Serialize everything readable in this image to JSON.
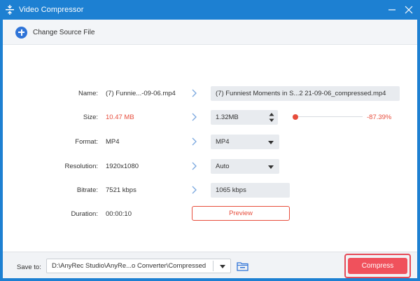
{
  "window": {
    "title": "Video Compressor"
  },
  "toolbar": {
    "change_source_label": "Change Source File"
  },
  "form": {
    "name": {
      "label": "Name:",
      "source": "(7) Funnie...-09-06.mp4",
      "output": "(7) Funniest Moments in S...2 21-09-06_compressed.mp4"
    },
    "size": {
      "label": "Size:",
      "source": "10.47 MB",
      "output": "1.32MB",
      "reduction": "-87.39%"
    },
    "format": {
      "label": "Format:",
      "source": "MP4",
      "output": "MP4"
    },
    "resolution": {
      "label": "Resolution:",
      "source": "1920x1080",
      "output": "Auto"
    },
    "bitrate": {
      "label": "Bitrate:",
      "source": "7521 kbps",
      "output": "1065 kbps"
    },
    "duration": {
      "label": "Duration:",
      "source": "00:00:10"
    },
    "preview_label": "Preview"
  },
  "footer": {
    "save_to_label": "Save to:",
    "save_path": "D:\\AnyRec Studio\\AnyRe...o Converter\\Compressed",
    "compress_label": "Compress"
  },
  "icons": {
    "app": "compress-icon",
    "minimize": "minimize-icon",
    "close": "close-icon",
    "add": "plus-circle-icon",
    "arrow": "chevron-right-icon",
    "dropdown": "caret-down-icon",
    "stepper": "up-down-stepper-icon",
    "folder": "folder-icon"
  },
  "colors": {
    "titlebar": "#1d80d2",
    "accent_blue": "#2f74d8",
    "accent_red": "#f0515c",
    "highlight_frame": "#e64a57",
    "negative_text": "#e74d3c"
  }
}
